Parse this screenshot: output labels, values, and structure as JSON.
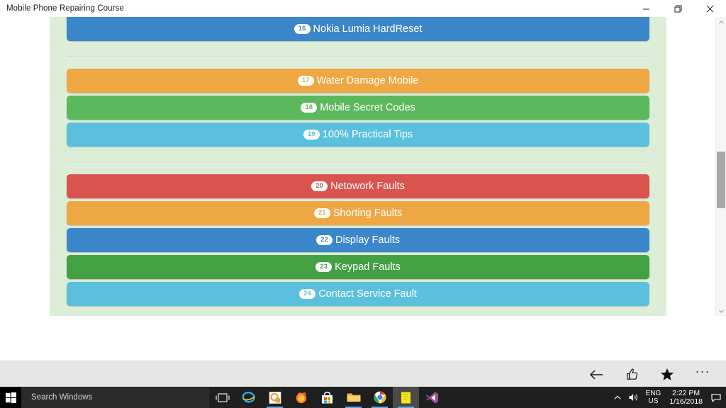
{
  "window": {
    "title": "Mobile Phone Repairing Course",
    "minimize_label": "Minimize",
    "restore_label": "Restore",
    "close_label": "Close"
  },
  "content": {
    "groups": [
      {
        "separator_after": true,
        "items": [
          {
            "number": "16",
            "label": "Nokia Lumia HardReset",
            "color": "#3c87ca",
            "clipped_top": true
          }
        ]
      },
      {
        "separator_after": true,
        "items": [
          {
            "number": "17",
            "label": "Water Damage Mobile",
            "color": "#efa744",
            "clipped_top": false
          },
          {
            "number": "18",
            "label": "Mobile Secret Codes",
            "color": "#5cb85c",
            "clipped_top": false
          },
          {
            "number": "19",
            "label": "100% Practical Tips",
            "color": "#5bc0de",
            "clipped_top": false
          }
        ]
      },
      {
        "separator_after": true,
        "items": [
          {
            "number": "20",
            "label": "Netowork Faults",
            "color": "#d9534f",
            "clipped_top": false
          },
          {
            "number": "21",
            "label": "Shorting Faults",
            "color": "#efa744",
            "clipped_top": false
          },
          {
            "number": "22",
            "label": "Display Faults",
            "color": "#3c87ca",
            "clipped_top": false
          },
          {
            "number": "23",
            "label": "Keypad Faults",
            "color": "#43a043",
            "clipped_top": false
          },
          {
            "number": "24",
            "label": "Contact Service Fault",
            "color": "#5bc0de",
            "clipped_top": false
          }
        ]
      },
      {
        "separator_after": false,
        "items": [
          {
            "number": "",
            "label": "",
            "color": "#d9534f",
            "clipped_top": false
          }
        ]
      }
    ]
  },
  "scrollbar": {
    "up_arrow": "scroll-up",
    "down_arrow": "scroll-down"
  },
  "bottom_toolbar": {
    "buttons": [
      {
        "name": "back-icon",
        "glyph": "back"
      },
      {
        "name": "thumbs-up-icon",
        "glyph": "thumbsup"
      },
      {
        "name": "favorites-star-icon",
        "glyph": "star"
      },
      {
        "name": "more-options-icon",
        "glyph": "dots",
        "label": "···"
      }
    ]
  },
  "taskbar": {
    "start_label": "Start",
    "search": {
      "placeholder": "Search Windows",
      "value": ""
    },
    "apps": [
      {
        "name": "task-view-icon",
        "label": "Task View"
      },
      {
        "name": "internet-explorer-icon",
        "label": "Internet Explorer"
      },
      {
        "name": "office-icon",
        "label": "Microsoft Office"
      },
      {
        "name": "firefox-icon",
        "label": "Mozilla Firefox"
      },
      {
        "name": "microsoft-store-icon",
        "label": "Microsoft Store"
      },
      {
        "name": "file-explorer-icon",
        "label": "File Explorer"
      },
      {
        "name": "google-chrome-icon",
        "label": "Google Chrome"
      },
      {
        "name": "notes-app-icon",
        "label": "Notes"
      },
      {
        "name": "visual-studio-icon",
        "label": "Visual Studio"
      }
    ],
    "tray": {
      "chevron": "show-hidden-icons",
      "volume": "volume-icon",
      "language_line1": "ENG",
      "language_line2": "US",
      "time": "2:22 PM",
      "date": "1/16/2018",
      "action_center": "notifications-icon"
    }
  }
}
